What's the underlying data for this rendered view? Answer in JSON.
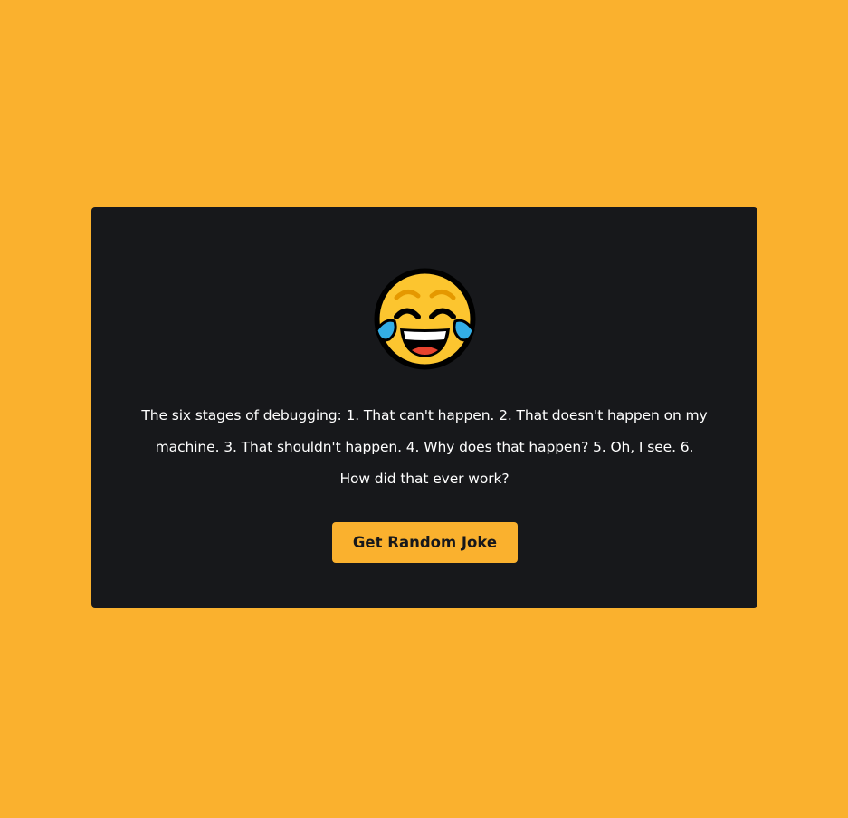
{
  "colors": {
    "background": "#fab12e",
    "card": "#17181b",
    "text": "#ffffff",
    "button": "#fab12e",
    "button_text": "#17181b"
  },
  "emoji": {
    "icon": "face-with-tears-of-joy-icon"
  },
  "joke": {
    "text": "The six stages of debugging: 1. That can't happen. 2. That doesn't happen on my machine. 3. That shouldn't happen. 4. Why does that happen? 5. Oh, I see. 6. How did that ever work?"
  },
  "button": {
    "label": "Get Random Joke"
  }
}
